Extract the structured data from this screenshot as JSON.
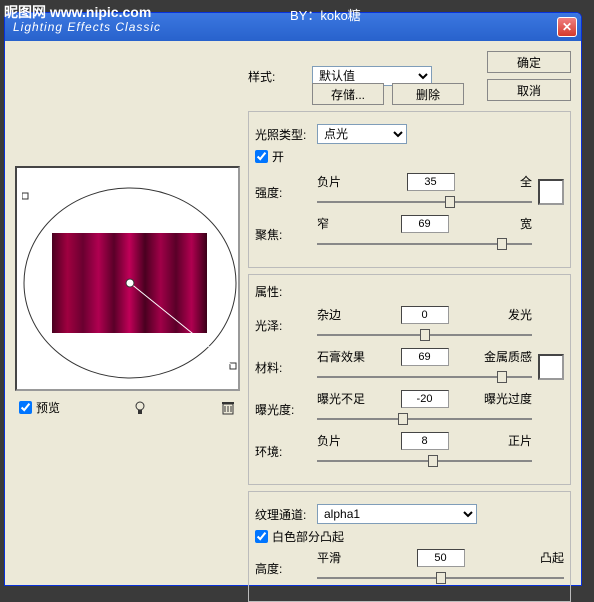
{
  "watermark": {
    "site": "昵图网 www.nipic.com",
    "by": "BY：koko糖"
  },
  "titlebar": {
    "title": "Lighting Effects Classic"
  },
  "buttons": {
    "ok": "确定",
    "cancel": "取消",
    "save": "存储...",
    "delete": "删除"
  },
  "style": {
    "label": "样式:",
    "value": "默认值"
  },
  "preview": {
    "label": "预览",
    "checked": true
  },
  "lightType": {
    "label": "光照类型:",
    "value": "点光",
    "on_label": "开",
    "on_checked": true,
    "intensity": {
      "label": "强度:",
      "left": "负片",
      "right": "全",
      "value": "35",
      "pos": 62
    },
    "focus": {
      "label": "聚焦:",
      "left": "窄",
      "right": "宽",
      "value": "69",
      "pos": 86
    }
  },
  "props": {
    "legend": "属性:",
    "gloss": {
      "label": "光泽:",
      "left": "杂边",
      "right": "发光",
      "value": "0",
      "pos": 50
    },
    "material": {
      "label": "材料:",
      "left": "石膏效果",
      "right": "金属质感",
      "value": "69",
      "pos": 86
    },
    "exposure": {
      "label": "曝光度:",
      "left": "曝光不足",
      "right": "曝光过度",
      "value": "-20",
      "pos": 40
    },
    "ambience": {
      "label": "环境:",
      "left": "负片",
      "right": "正片",
      "value": "8",
      "pos": 54
    }
  },
  "texture": {
    "legend": "纹理通道:",
    "value": "alpha1",
    "whiteHigh_label": "白色部分凸起",
    "whiteHigh_checked": true,
    "height": {
      "label": "高度:",
      "left": "平滑",
      "right": "凸起",
      "value": "50",
      "pos": 50
    }
  }
}
